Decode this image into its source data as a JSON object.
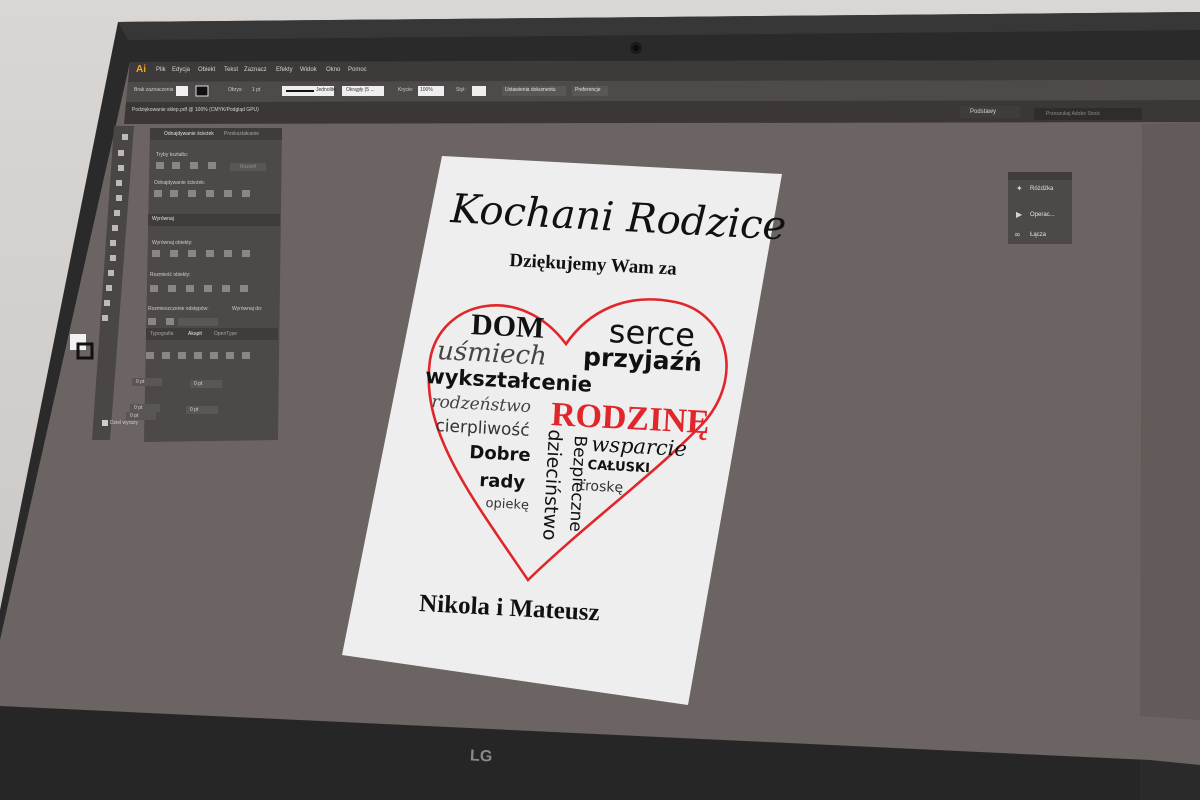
{
  "app": {
    "logo": "Ai",
    "menu": [
      "Plik",
      "Edycja",
      "Obiekt",
      "Tekst",
      "Zaznacz",
      "Efekty",
      "Widok",
      "Okno",
      "Pomoc"
    ],
    "control_bar": {
      "no_selection": "Brak zaznaczenia",
      "stroke_label": "Obrys:",
      "stroke_value": "1 pt",
      "stroke_style": "Jednolite",
      "brush": "Okrągły (5 ...",
      "opacity_label": "Krycie:",
      "opacity_value": "100%",
      "style_label": "Styl:",
      "doc_setup_button": "Ustawienia dokumentu",
      "preferences_button": "Preferencje"
    },
    "workspace": "Podstawy",
    "search_placeholder": "Przeszukaj Adobe Stock",
    "document_tab": "Podziękowanie sklep.pdf @ 100% (CMYK/Podgląd GPU)"
  },
  "panels": {
    "pathfinder": {
      "tabs": [
        "Odnajdywanie ścieżek",
        "Przekształcanie"
      ],
      "shape_modes": "Tryby kształtu:",
      "pathfinders": "Odnajdywanie ścieżek:",
      "expand_button": "Rozwiń"
    },
    "align": {
      "title": "Wyrównaj",
      "align_objects": "Wyrównaj obiekty:",
      "distribute_objects": "Rozmieść obiekty:",
      "distribute_spacing": "Rozmieszczenie odstępów:",
      "align_to": "Wyrównaj do:"
    },
    "type": {
      "tabs": [
        "Typografia",
        "Akapit",
        "OpenType"
      ],
      "values": [
        "0 pt",
        "0 pt",
        "0 pt",
        "0 pt",
        "0 pt"
      ],
      "hyphenate": "Dziel wyrazy"
    },
    "right": {
      "items": [
        "Różdżka",
        "Operac...",
        "Łącza"
      ]
    }
  },
  "card": {
    "title": "Kochani Rodzice",
    "subtitle": "Dziękujemy Wam za",
    "words": {
      "dom": "DOM",
      "serce": "serce",
      "usmiech": "uśmiech",
      "przyjazn": "przyjaźń",
      "wyksztalcenie": "wykształcenie",
      "rodzenstwo": "rodzeństwo",
      "rodzine": "RODZINĘ",
      "cierpliwosc": "cierpliwość",
      "wsparcie": "wsparcie",
      "dobre": "Dobre",
      "rady": "rady",
      "bezpieczne": "Bezpieczne",
      "dziecinstwo": "dzieciństwo",
      "caluski": "CAŁUSKI",
      "troske": "troskę",
      "opieke": "opiekę"
    },
    "signature": "Nikola i Mateusz",
    "heart_color": "#e0262b"
  },
  "monitor": {
    "brand": "LG"
  }
}
